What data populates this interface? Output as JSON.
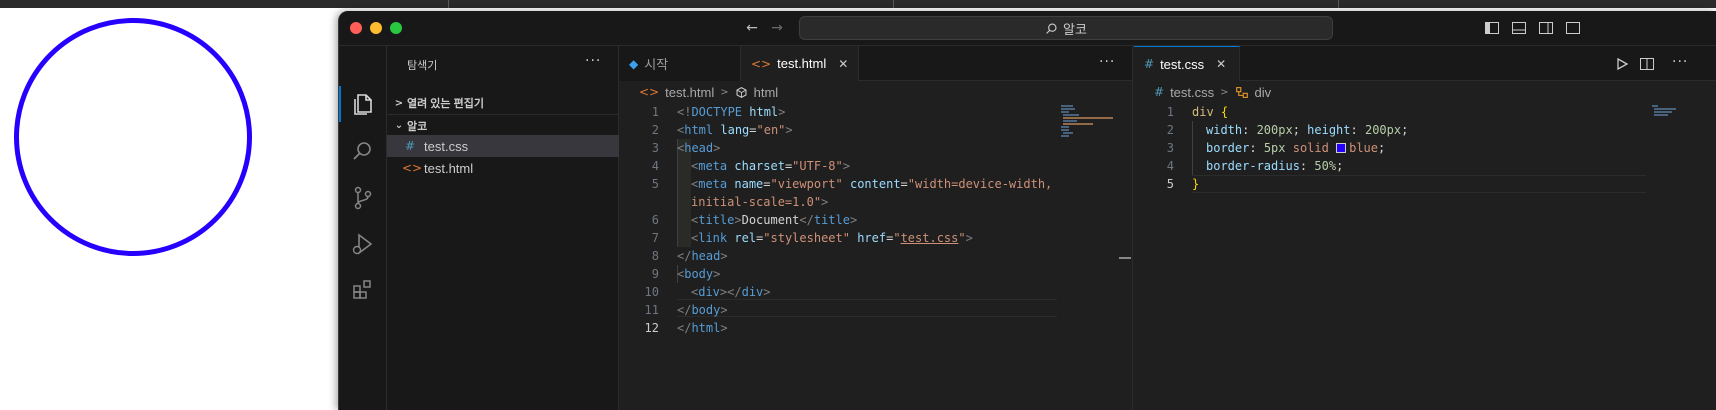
{
  "window": {
    "command_center": "알코"
  },
  "sidebar": {
    "title": "탐색기",
    "sections": {
      "open_editors": "열려 있는 편집기",
      "project": "알코"
    },
    "files": [
      "test.css",
      "test.html"
    ]
  },
  "left_editor": {
    "tabs": [
      {
        "label": "시작",
        "icon": "vscode-logo-icon"
      },
      {
        "label": "test.html",
        "icon": "html-file-icon"
      }
    ],
    "breadcrumb": [
      "test.html",
      "html"
    ],
    "line_numbers": [
      "1",
      "2",
      "3",
      "4",
      "5",
      "",
      "6",
      "7",
      "8",
      "9",
      "10",
      "11",
      "12"
    ],
    "current_line": "12"
  },
  "right_editor": {
    "tabs": [
      {
        "label": "test.css",
        "icon": "css-file-icon"
      }
    ],
    "breadcrumb": [
      "test.css",
      "div"
    ],
    "line_numbers": [
      "1",
      "2",
      "3",
      "4",
      "5"
    ],
    "current_line": "5"
  },
  "code_html": {
    "l1": [
      "<!",
      "DOCTYPE",
      " html",
      ">"
    ],
    "l2": [
      "<",
      "html",
      " lang",
      "=",
      "\"en\"",
      ">"
    ],
    "l3": [
      "<",
      "head",
      ">"
    ],
    "l4": [
      "<",
      "meta",
      " charset",
      "=",
      "\"UTF-8\"",
      ">"
    ],
    "l5": [
      "<",
      "meta",
      " name",
      "=",
      "\"viewport\"",
      " content",
      "=",
      "\"width=device-width,"
    ],
    "l5b": [
      "initial-scale=1.0\"",
      ">"
    ],
    "l6": [
      "<",
      "title",
      ">",
      "Document",
      "</",
      "title",
      ">"
    ],
    "l7": [
      "<",
      "link",
      " rel",
      "=",
      "\"stylesheet\"",
      " href",
      "=",
      "\"",
      "test.css",
      "\"",
      ">"
    ],
    "l8": [
      "</",
      "head",
      ">"
    ],
    "l9": [
      "<",
      "body",
      ">"
    ],
    "l10": [
      "<",
      "div",
      "></",
      "div",
      ">"
    ],
    "l11": [
      "</",
      "body",
      ">"
    ],
    "l12": [
      "</",
      "html",
      ">"
    ]
  },
  "code_css": {
    "l1": [
      "div",
      " ",
      "{"
    ],
    "l2": [
      "width",
      ": ",
      "200px",
      "; ",
      "height",
      ": ",
      "200px",
      ";"
    ],
    "l3": [
      "border",
      ": ",
      "5px",
      " ",
      "solid",
      " ",
      "blue",
      ";"
    ],
    "l4": [
      "border-radius",
      ": ",
      "50%",
      ";"
    ],
    "l5": [
      "}"
    ]
  },
  "colors": {
    "preview_circle": "#2600ff",
    "swatch_blue": "#2600ff",
    "accent": "#0078d4"
  }
}
